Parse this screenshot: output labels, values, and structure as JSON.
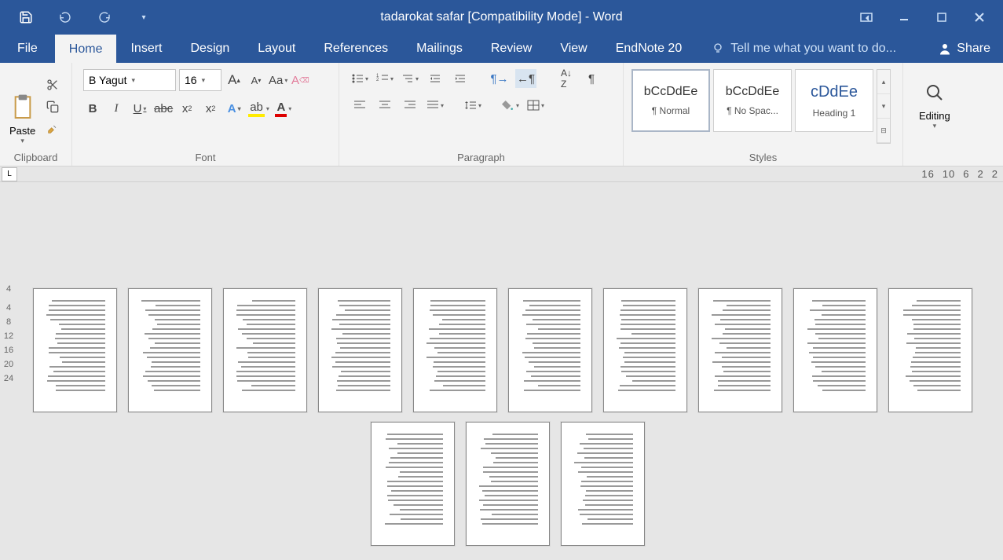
{
  "titlebar": {
    "title": "tadarokat safar [Compatibility Mode] - Word"
  },
  "tabs": {
    "file": "File",
    "home": "Home",
    "insert": "Insert",
    "design": "Design",
    "layout": "Layout",
    "references": "References",
    "mailings": "Mailings",
    "review": "Review",
    "view": "View",
    "endnote": "EndNote 20",
    "tellme": "Tell me what you want to do...",
    "share": "Share"
  },
  "ribbon": {
    "clipboard": {
      "label": "Clipboard",
      "paste": "Paste"
    },
    "font": {
      "label": "Font",
      "name": "B Yagut",
      "size": "16"
    },
    "paragraph": {
      "label": "Paragraph"
    },
    "styles": {
      "label": "Styles",
      "items": [
        {
          "preview": "bCcDdEe",
          "name": "¶ Normal"
        },
        {
          "preview": "bCcDdEe",
          "name": "¶ No Spac..."
        },
        {
          "preview": "cDdEe",
          "name": "Heading 1"
        }
      ]
    },
    "editing": {
      "label": "Editing"
    }
  },
  "ruler": {
    "left": "L",
    "right": [
      "16",
      "10",
      "6",
      "2",
      "2"
    ],
    "vertical": [
      "4",
      "",
      "4",
      "8",
      "12",
      "16",
      "20",
      "24"
    ]
  }
}
